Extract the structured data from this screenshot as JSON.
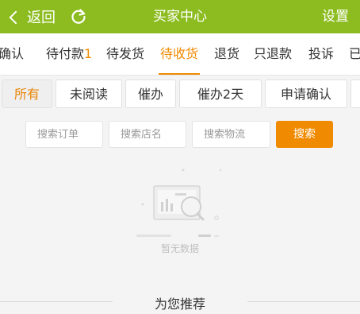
{
  "header": {
    "back_label": "返回",
    "title": "买家中心",
    "settings_label": "设置",
    "background": "#8cbc1f"
  },
  "tabs": [
    {
      "label": "待确认",
      "count": ""
    },
    {
      "label": "待付款",
      "count": "1"
    },
    {
      "label": "待发货",
      "count": ""
    },
    {
      "label": "待收货",
      "count": "",
      "active": true
    },
    {
      "label": "退货",
      "count": ""
    },
    {
      "label": "只退款",
      "count": ""
    },
    {
      "label": "投诉",
      "count": ""
    },
    {
      "label": "已",
      "count": ""
    }
  ],
  "filters": [
    {
      "label": "所有",
      "active": true
    },
    {
      "label": "未阅读"
    },
    {
      "label": "催办"
    },
    {
      "label": "催办2天"
    },
    {
      "label": "申请确认"
    }
  ],
  "search": {
    "order_placeholder": "搜索订单",
    "shop_placeholder": "搜索店名",
    "logistics_placeholder": "搜索物流",
    "button_label": "搜索"
  },
  "empty_state": {
    "text": "暂无数据"
  },
  "recommend": {
    "label": "为您推荐"
  },
  "colors": {
    "accent": "#f08a00",
    "header": "#8cbc1f"
  }
}
